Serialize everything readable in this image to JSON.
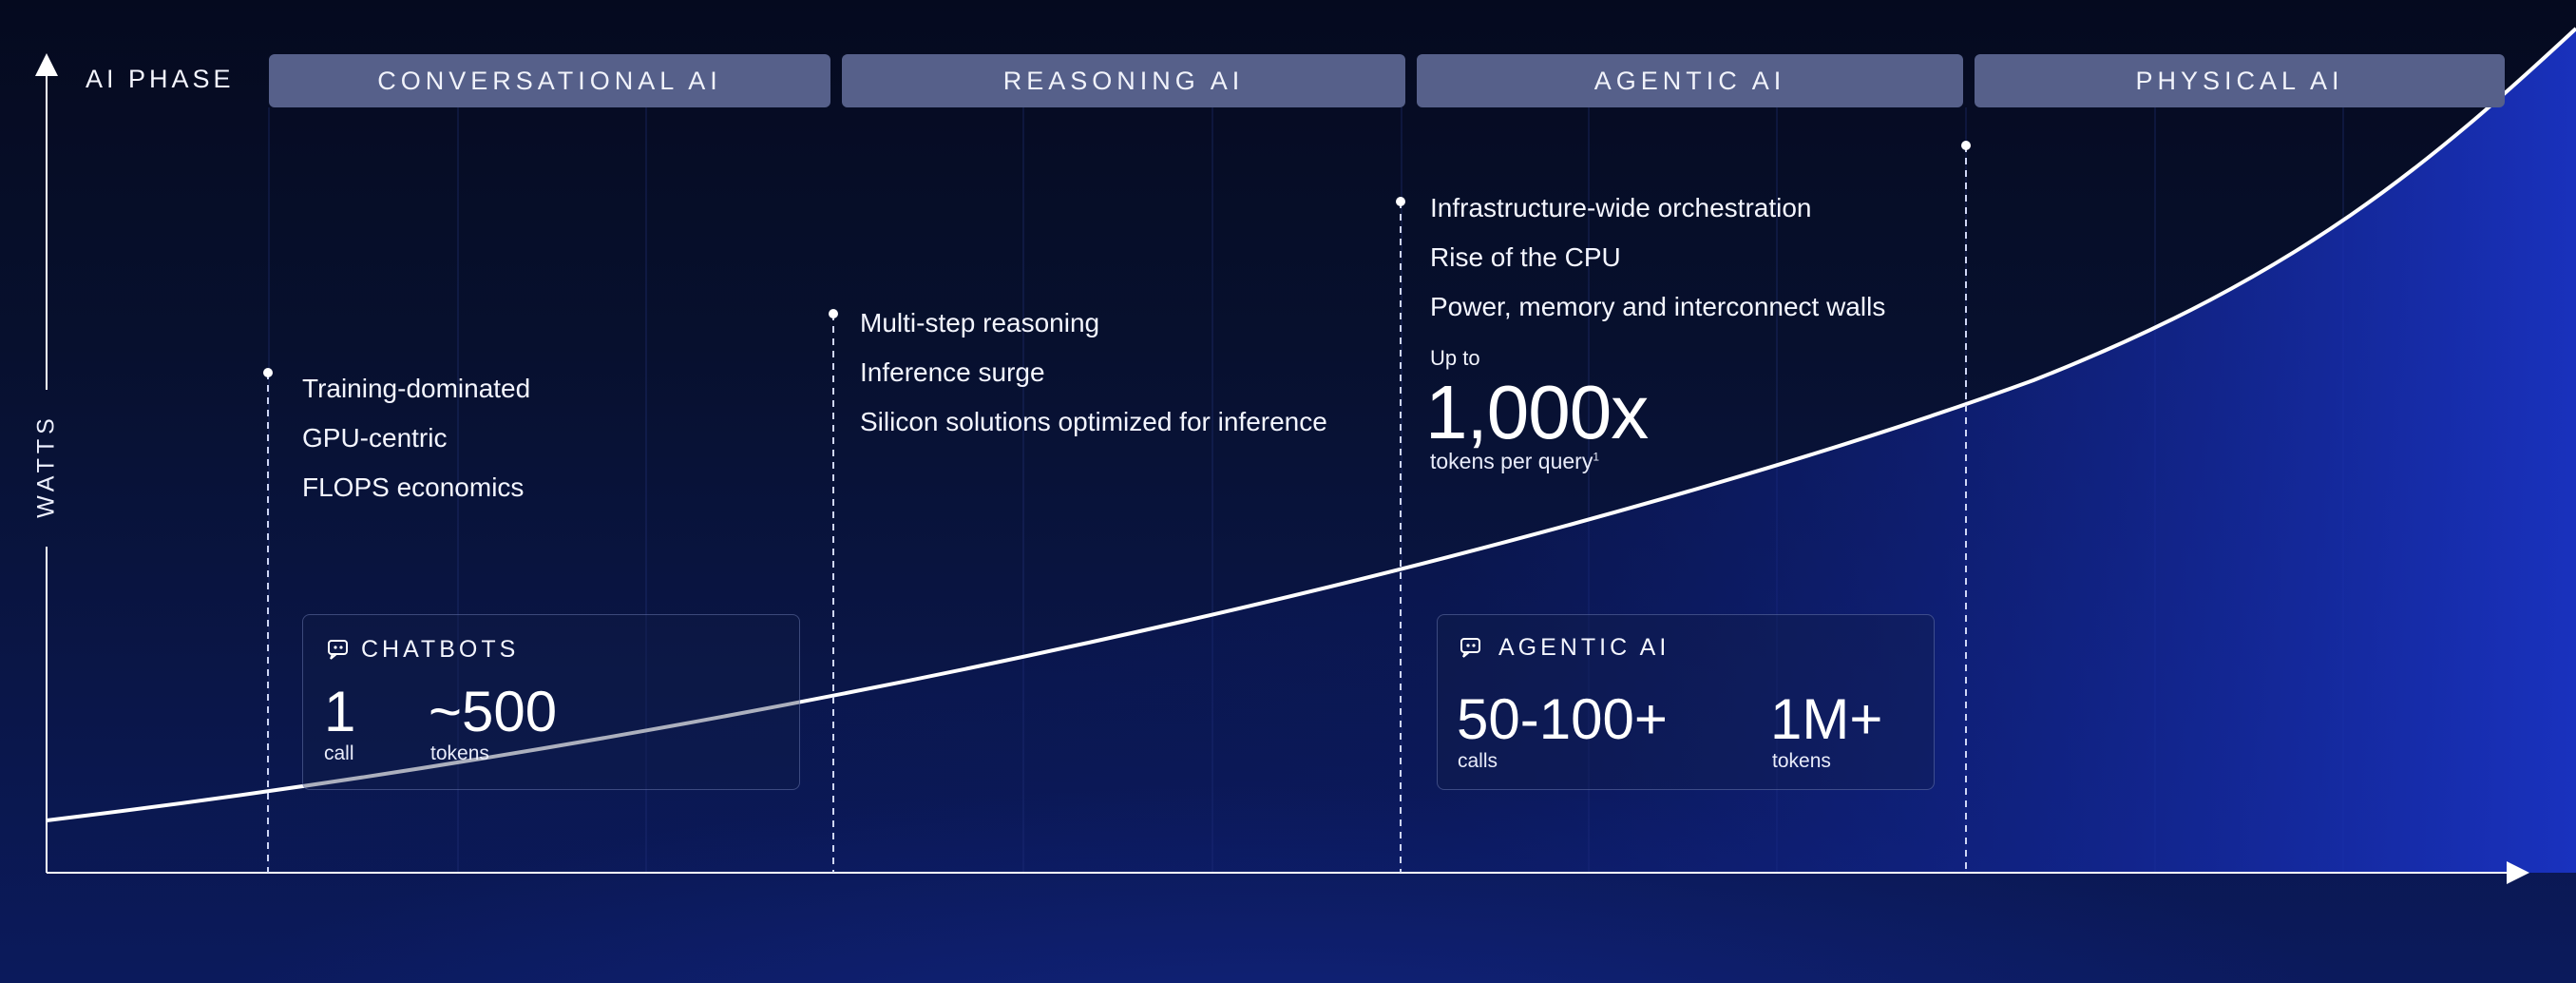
{
  "header": {
    "phase_label": "AI PHASE",
    "phases": [
      "CONVERSATIONAL AI",
      "REASONING AI",
      "AGENTIC AI",
      "PHYSICAL AI"
    ],
    "tab_color": "#56608a"
  },
  "axis": {
    "y_label": "WATTS"
  },
  "conversational": {
    "bullets": [
      "Training-dominated",
      "GPU-centric",
      "FLOPS economics"
    ],
    "card": {
      "title": "CHATBOTS",
      "stat1_value": "1",
      "stat1_label": "call",
      "stat2_value": "~500",
      "stat2_label": "tokens"
    }
  },
  "reasoning": {
    "bullets": [
      "Multi-step reasoning",
      "Inference surge",
      "Silicon solutions optimized for inference"
    ]
  },
  "agentic": {
    "bullets": [
      "Infrastructure-wide orchestration",
      "Rise of the CPU",
      "Power, memory and interconnect walls"
    ],
    "highlight": {
      "prefix": "Up to",
      "value": "1,000x",
      "suffix": "tokens per query",
      "footnote": "1"
    },
    "card": {
      "title": "AGENTIC AI",
      "stat1_value": "50-100+",
      "stat1_label": "calls",
      "stat2_value": "1M+",
      "stat2_label": "tokens"
    }
  },
  "colors": {
    "background": "#07102e",
    "curve": "#ffffff",
    "fill": "#1326a8"
  }
}
